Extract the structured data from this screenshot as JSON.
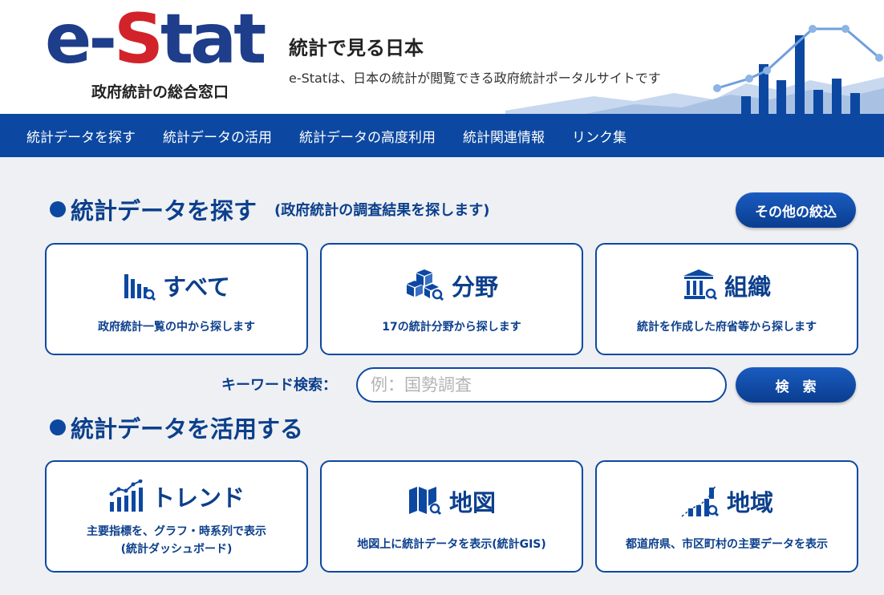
{
  "header": {
    "logo_text_a": "e-",
    "logo_text_b": "S",
    "logo_text_c": "tat",
    "logo_sub": "政府統計の総合窓口",
    "tagline": "統計で見る日本",
    "tagline_sub": "e-Statは、日本の統計が閲覧できる政府統計ポータルサイトです"
  },
  "nav": {
    "items": [
      {
        "label": "統計データを探す"
      },
      {
        "label": "統計データの活用"
      },
      {
        "label": "統計データの高度利用"
      },
      {
        "label": "統計関連情報"
      },
      {
        "label": "リンク集"
      }
    ]
  },
  "search_section": {
    "title": "統計データを探す",
    "subtitle": "(政府統計の調査結果を探します)",
    "other_filter_label": "その他の絞込",
    "cards": [
      {
        "title": "すべて",
        "desc": "政府統計一覧の中から探します",
        "icon": "bar-chart-search-icon"
      },
      {
        "title": "分野",
        "desc": "17の統計分野から探します",
        "icon": "boxes-search-icon"
      },
      {
        "title": "組織",
        "desc": "統計を作成した府省等から探します",
        "icon": "building-search-icon"
      }
    ],
    "keyword_label": "キーワード検索：",
    "keyword_placeholder": "例：国勢調査",
    "keyword_value": "",
    "search_button": "検　索"
  },
  "use_section": {
    "title": "統計データを活用する",
    "cards": [
      {
        "title": "トレンド",
        "desc_line1": "主要指標を、グラフ・時系列で表示",
        "desc_line2": "(統計ダッシュボード)",
        "icon": "trend-chart-icon"
      },
      {
        "title": "地図",
        "desc_line1": "地図上に統計データを表示(統計GIS)",
        "icon": "map-search-icon"
      },
      {
        "title": "地域",
        "desc_line1": "都道府県、市区町村の主要データを表示",
        "icon": "region-chart-icon"
      }
    ]
  },
  "colors": {
    "brand_blue": "#0c48a1",
    "logo_red": "#d2232a",
    "text_blue": "#0c3f8c",
    "background": "#eef0f3"
  }
}
